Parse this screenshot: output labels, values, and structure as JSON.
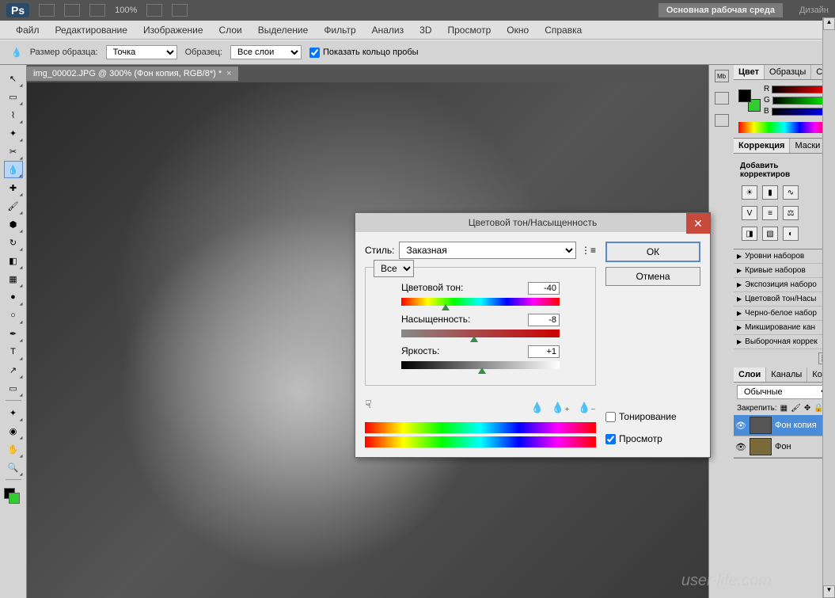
{
  "topbar": {
    "logo": "Ps",
    "zoom": "100%",
    "workspace_btn": "Основная рабочая среда",
    "workspace_label": "Дизайн"
  },
  "menu": [
    "Файл",
    "Редактирование",
    "Изображение",
    "Слои",
    "Выделение",
    "Фильтр",
    "Анализ",
    "3D",
    "Просмотр",
    "Окно",
    "Справка"
  ],
  "options": {
    "sample_size_label": "Размер образца:",
    "sample_size_value": "Точка",
    "sample_label": "Образец:",
    "sample_value": "Все слои",
    "show_ring": "Показать кольцо пробы"
  },
  "document": {
    "tab": "img_00002.JPG @ 300% (Фон копия, RGB/8*) *"
  },
  "dialog": {
    "title": "Цветовой тон/Насыщенность",
    "style_label": "Стиль:",
    "style_value": "Заказная",
    "scope": "Все",
    "hue_label": "Цветовой тон:",
    "hue_value": "-40",
    "sat_label": "Насыщенность:",
    "sat_value": "-8",
    "light_label": "Яркость:",
    "light_value": "+1",
    "ok": "ОК",
    "cancel": "Отмена",
    "colorize": "Тонирование",
    "preview": "Просмотр"
  },
  "panels": {
    "color_tabs": [
      "Цвет",
      "Образцы",
      "Стил"
    ],
    "rgb": [
      "R",
      "G",
      "B"
    ],
    "correction_tabs": [
      "Коррекция",
      "Маски"
    ],
    "correction_title": "Добавить корректиров",
    "presets": [
      "Уровни наборов",
      "Кривые наборов",
      "Экспозиция наборо",
      "Цветовой тон/Насы",
      "Черно-белое набор",
      "Микширование кан",
      "Выборочная коррек"
    ],
    "layers_tabs": [
      "Слои",
      "Каналы",
      "Конту"
    ],
    "blend_mode": "Обычные",
    "lock_label": "Закрепить:",
    "layers": [
      {
        "name": "Фон копия",
        "active": true
      },
      {
        "name": "Фон",
        "active": false
      }
    ]
  },
  "watermark": "user-life.com"
}
